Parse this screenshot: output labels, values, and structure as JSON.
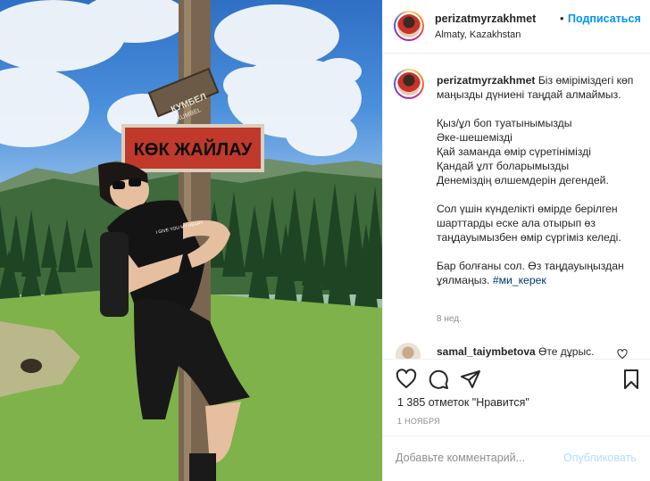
{
  "post": {
    "username": "perizatmyrzakhmet",
    "separator": "•",
    "follow_label": "Подписаться",
    "location": "Almaty, Kazakhstan"
  },
  "photo": {
    "sign_main": "КӨК ЖАЙЛАУ",
    "sign_small_top": "КУМБЕЛ",
    "sign_small_bottom": "KUMBEL",
    "shirt_text": "I GIVE YOU MY HEART"
  },
  "caption": {
    "username": "perizatmyrzakhmet",
    "line1": "Біз өміріміздегі көп маңызды дүниені таңдай алмаймыз.",
    "p2": [
      "Қыз/ұл боп туатынымызды",
      "Әке-шешемізді",
      "Қай заманда өмір сүретінімізді",
      "Қандай ұлт боларымызды",
      "Денеміздің өлшемдерін дегендей."
    ],
    "p3": "Сол үшін күнделікті өмірде берілген шарттарды еске ала отырып өз таңдауымызбен өмір сүргіміз келеді.",
    "p4": "Бар болғаны сол. Өз таңдауыңыздан ұялмаңыз.",
    "hashtag": "#ми_керек",
    "time": "8 нед."
  },
  "comment": {
    "username": "samal_taiymbetova",
    "text": "Өте дұрыс."
  },
  "actions": {
    "icons": [
      "heart-icon",
      "comment-icon",
      "share-icon",
      "bookmark-icon"
    ]
  },
  "likes_text": "1 385 отметок \"Нравится\"",
  "date": "1 НОЯБРЯ",
  "comment_box": {
    "placeholder": "Добавьте комментарий...",
    "publish_label": "Опубликовать"
  },
  "colors": {
    "accent": "#0095f6",
    "hashtag": "#00376b",
    "publish_disabled": "#b2dffc",
    "sign_red": "#c0392b"
  }
}
